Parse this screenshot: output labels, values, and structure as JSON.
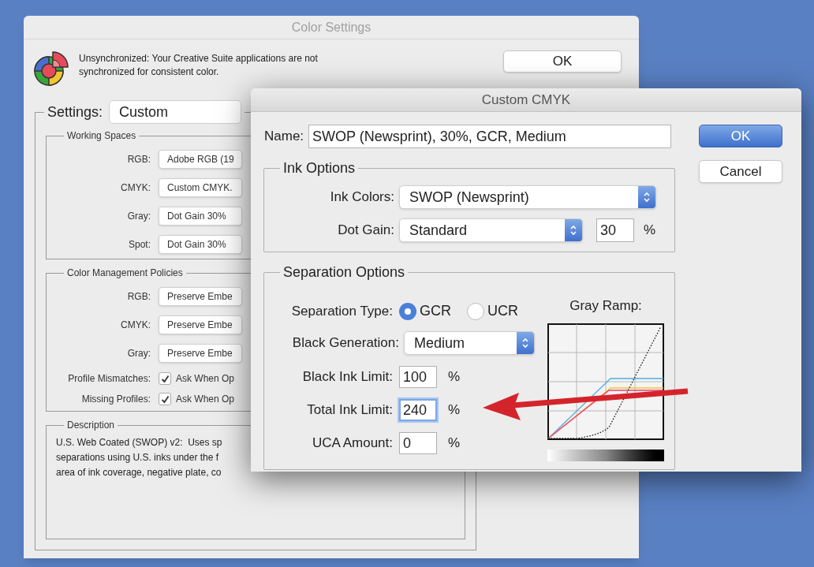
{
  "color_settings": {
    "title": "Color Settings",
    "message": "Unsynchronized: Your Creative Suite applications are not synchronized for consistent color.",
    "ok_button": "OK",
    "settings_label": "Settings:",
    "settings_value": "Custom",
    "working_spaces": {
      "legend": "Working Spaces",
      "rows": [
        {
          "label": "RGB:",
          "value": "Adobe RGB (19"
        },
        {
          "label": "CMYK:",
          "value": "Custom CMYK."
        },
        {
          "label": "Gray:",
          "value": "Dot Gain 30%"
        },
        {
          "label": "Spot:",
          "value": "Dot Gain 30%"
        }
      ]
    },
    "policies": {
      "legend": "Color Management Policies",
      "rows": [
        {
          "label": "RGB:",
          "value": "Preserve Embe"
        },
        {
          "label": "CMYK:",
          "value": "Preserve Embe"
        },
        {
          "label": "Gray:",
          "value": "Preserve Embe"
        }
      ],
      "checks": [
        {
          "label": "Profile Mismatches:",
          "text": "Ask When Op",
          "checked": true
        },
        {
          "label": "Missing Profiles:",
          "text": "Ask When Op",
          "checked": true
        }
      ]
    },
    "description": {
      "legend": "Description",
      "lines": [
        "U.S. Web Coated (SWOP) v2:  Uses sp",
        "separations using U.S. inks under the f",
        "area of ink coverage, negative plate, co"
      ]
    }
  },
  "custom_cmyk": {
    "title": "Custom CMYK",
    "name_label": "Name:",
    "name_value": "SWOP (Newsprint), 30%, GCR, Medium",
    "buttons": [
      {
        "label": "OK",
        "default": true
      },
      {
        "label": "Cancel",
        "default": false
      }
    ],
    "ink_options": {
      "legend": "Ink Options",
      "ink_colors": {
        "label": "Ink Colors:",
        "value": "SWOP (Newsprint)"
      },
      "dot_gain": {
        "label": "Dot Gain:",
        "value": "Standard",
        "amount": "30",
        "unit": "%"
      }
    },
    "separation": {
      "legend": "Separation Options",
      "type_label": "Separation Type:",
      "radios": [
        {
          "label": "GCR",
          "selected": true
        },
        {
          "label": "UCR",
          "selected": false
        }
      ],
      "black_generation": {
        "label": "Black Generation:",
        "value": "Medium"
      },
      "fields": [
        {
          "label": "Black Ink Limit:",
          "value": "100",
          "unit": "%",
          "focused": false
        },
        {
          "label": "Total Ink Limit:",
          "value": "240",
          "unit": "%",
          "focused": true
        },
        {
          "label": "UCA Amount:",
          "value": "0",
          "unit": "%",
          "focused": false
        }
      ],
      "gray_ramp_title": "Gray Ramp:"
    }
  }
}
